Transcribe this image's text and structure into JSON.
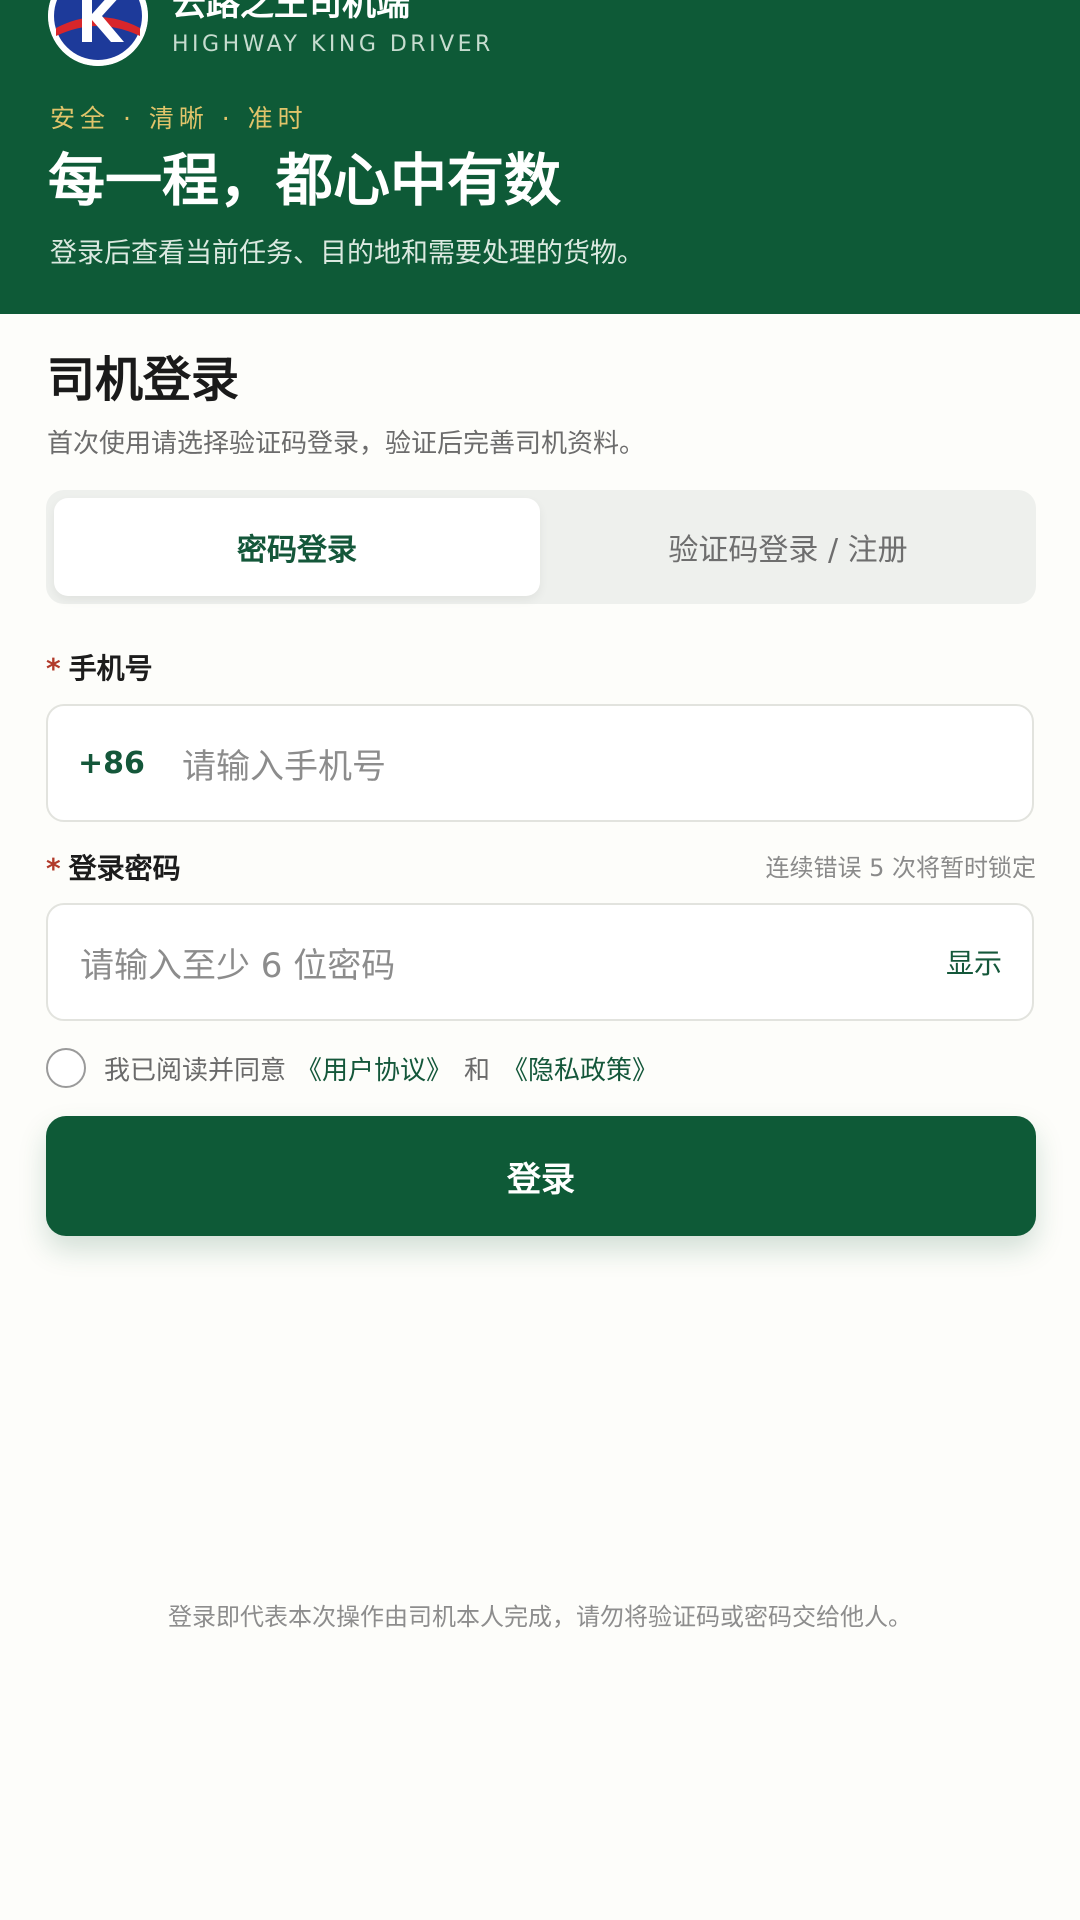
{
  "header": {
    "app_title": "云路之王司机端",
    "app_subtitle": "HIGHWAY KING DRIVER",
    "tagline": "安全 · 清晰 · 准时",
    "headline": "每一程，都心中有数",
    "description": "登录后查看当前任务、目的地和需要处理的货物。",
    "logo_icon": "highway-king-logo-icon",
    "colors": {
      "brand_green": "#0e5a37",
      "tagline_gold": "#e1c46a"
    }
  },
  "login": {
    "title": "司机登录",
    "subtitle": "首次使用请选择验证码登录，验证后完善司机资料。",
    "tabs": [
      {
        "label": "密码登录",
        "active": true
      },
      {
        "label": "验证码登录 / 注册",
        "active": false
      }
    ],
    "phone": {
      "required_mark": "*",
      "label": "手机号",
      "prefix": "+86",
      "placeholder": "请输入手机号",
      "value": ""
    },
    "password": {
      "required_mark": "*",
      "label": "登录密码",
      "hint": "连续错误 5 次将暂时锁定",
      "placeholder": "请输入至少 6 位密码",
      "value": "",
      "toggle_label": "显示"
    },
    "agreement": {
      "checked": false,
      "prefix": "我已阅读并同意",
      "user_agreement": "《用户协议》",
      "and": "和",
      "privacy_policy": "《隐私政策》"
    },
    "submit_label": "登录"
  },
  "footer": {
    "note": "登录即代表本次操作由司机本人完成，请勿将验证码或密码交给他人。"
  }
}
